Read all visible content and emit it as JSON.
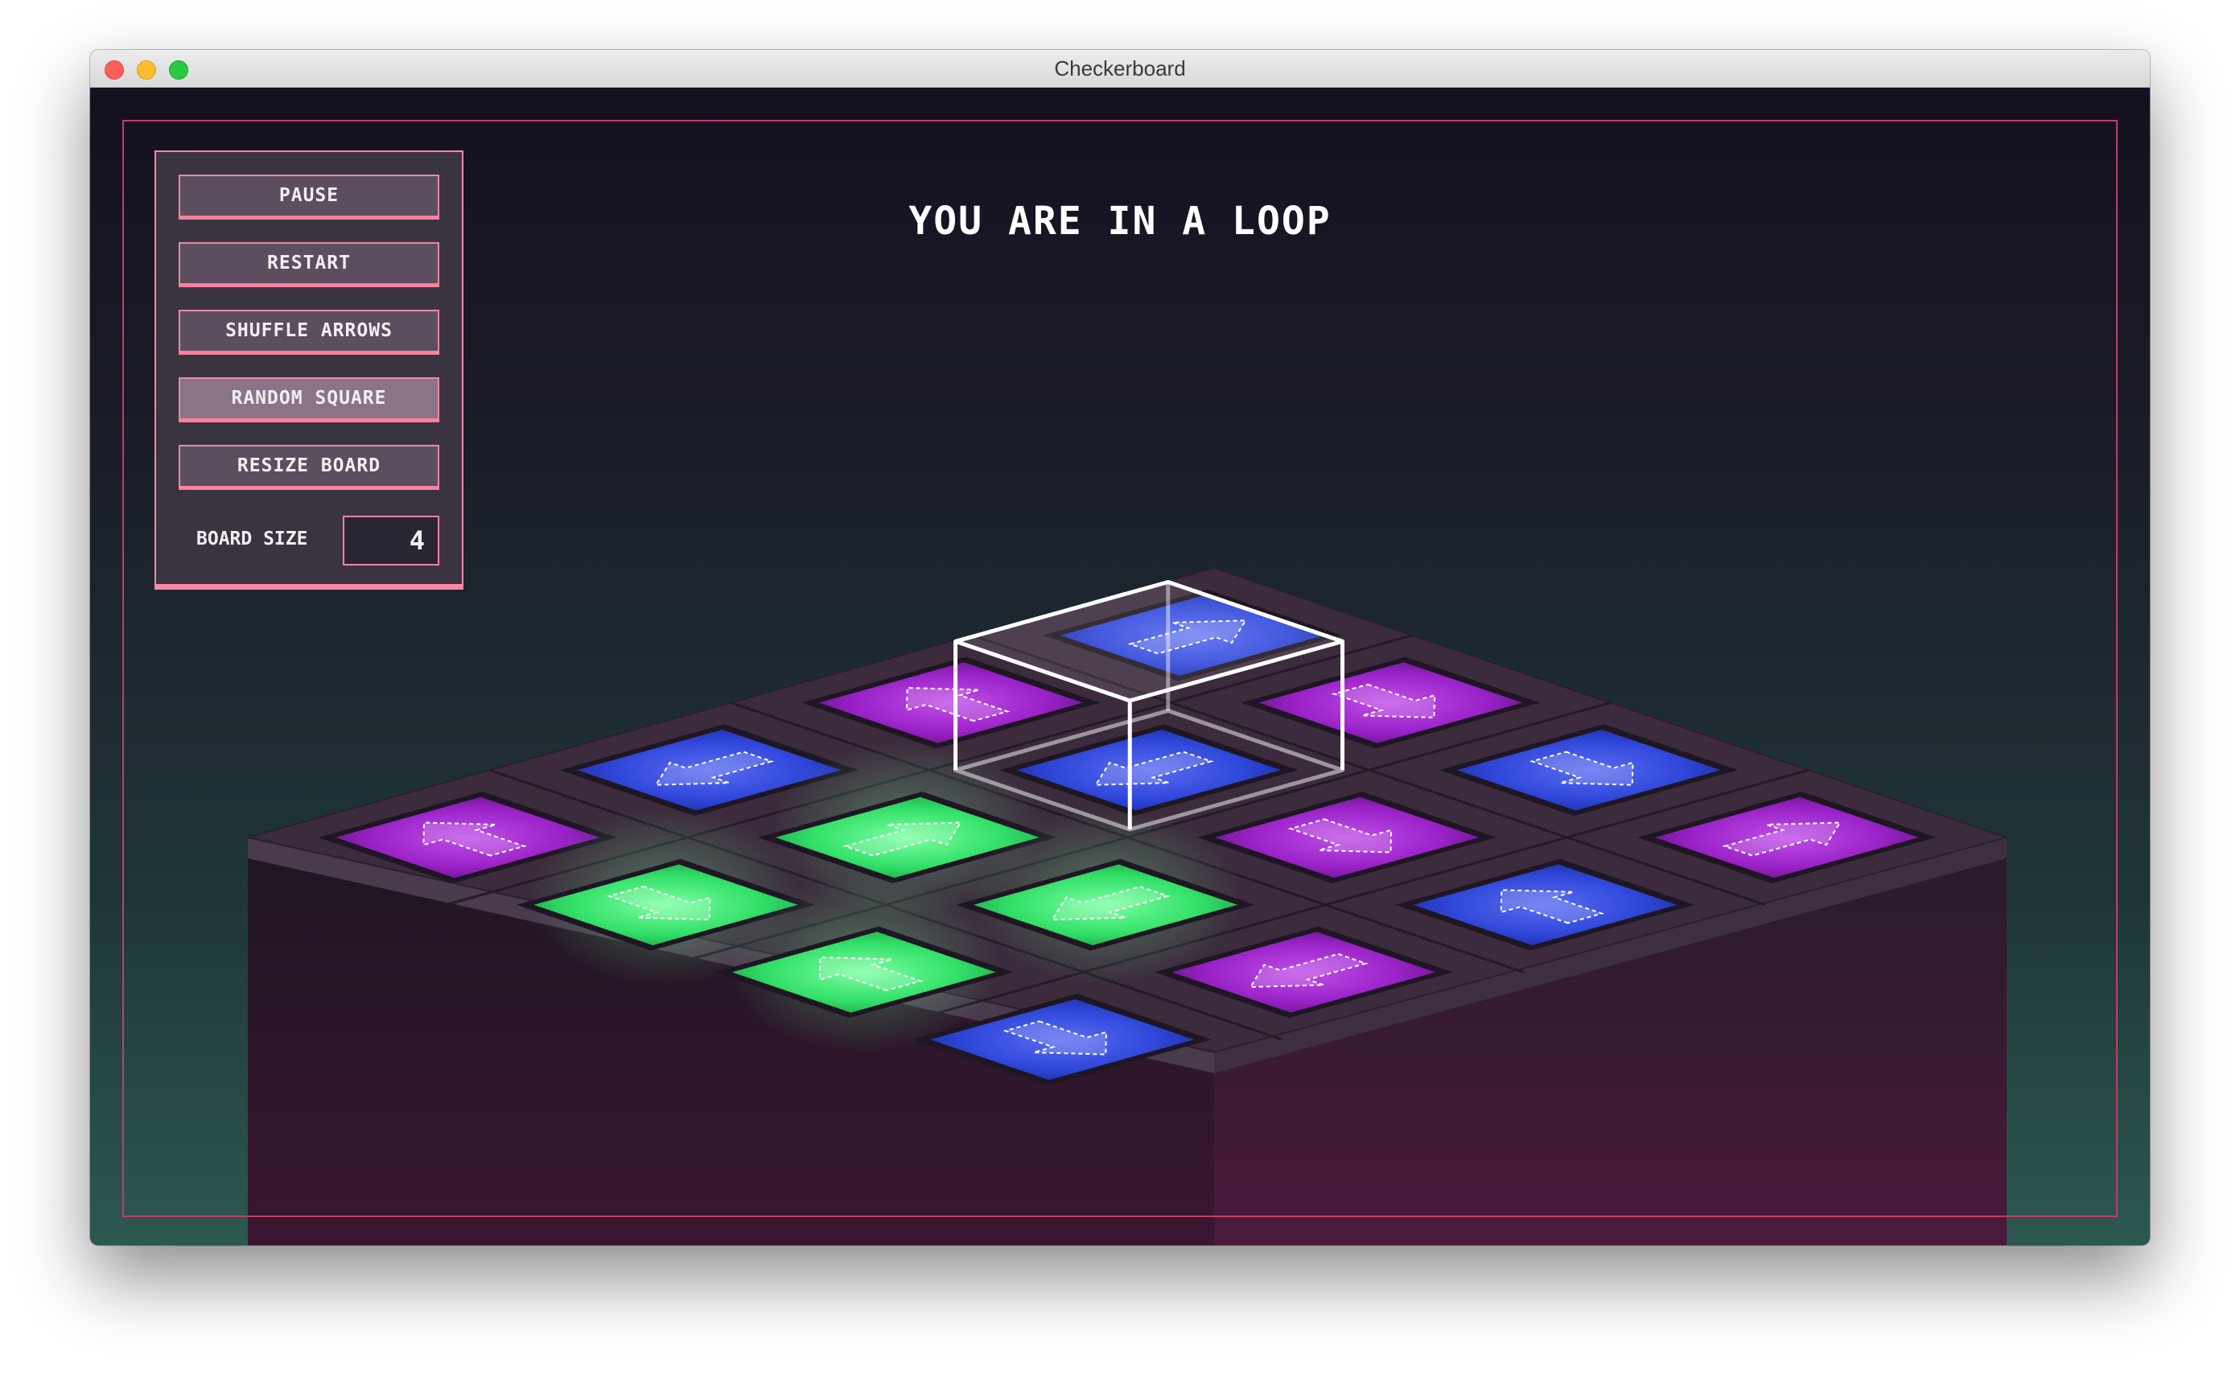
{
  "window": {
    "title": "Checkerboard"
  },
  "controls": {
    "buttons": [
      {
        "label": "PAUSE",
        "state": "normal"
      },
      {
        "label": "RESTART",
        "state": "normal"
      },
      {
        "label": "SHUFFLE ARROWS",
        "state": "normal"
      },
      {
        "label": "RANDOM SQUARE",
        "state": "hover"
      },
      {
        "label": "RESIZE BOARD",
        "state": "normal"
      }
    ],
    "board_size_label": "BOARD SIZE",
    "board_size_value": "4"
  },
  "status": {
    "message": "YOU ARE IN A LOOP"
  },
  "board": {
    "size": 4,
    "rows": [
      [
        {
          "color": "blue",
          "arrow": "up"
        },
        {
          "color": "purple",
          "arrow": "right"
        },
        {
          "color": "blue",
          "arrow": "right"
        },
        {
          "color": "purple",
          "arrow": "up"
        }
      ],
      [
        {
          "color": "purple",
          "arrow": "left"
        },
        {
          "color": "blue",
          "arrow": "down"
        },
        {
          "color": "purple",
          "arrow": "right"
        },
        {
          "color": "blue",
          "arrow": "left"
        }
      ],
      [
        {
          "color": "blue",
          "arrow": "down"
        },
        {
          "color": "green",
          "arrow": "up"
        },
        {
          "color": "green",
          "arrow": "down"
        },
        {
          "color": "purple",
          "arrow": "down"
        }
      ],
      [
        {
          "color": "purple",
          "arrow": "left"
        },
        {
          "color": "green",
          "arrow": "right"
        },
        {
          "color": "green",
          "arrow": "left"
        },
        {
          "color": "blue",
          "arrow": "right"
        }
      ]
    ],
    "cursor": {
      "row": 1,
      "col": 1
    }
  },
  "colors": {
    "accent": "#ff7fa0",
    "frame": "#c73a66",
    "panel_bg": "#3a3441",
    "button_bg": "#5b4f5f",
    "button_active_bg": "#8a7486",
    "tile_blue": "#2f47d9",
    "tile_purple": "#9a22c8",
    "tile_green": "#32e068",
    "board_top": "#3b2b3c",
    "cursor_stroke": "#ffffff"
  }
}
